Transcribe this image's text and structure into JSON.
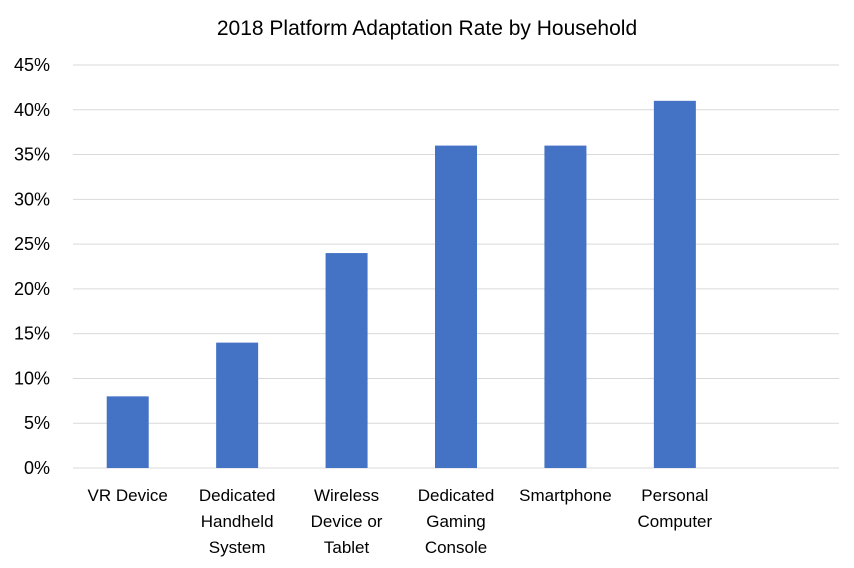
{
  "chart_data": {
    "type": "bar",
    "title": "2018 Platform Adaptation Rate by Household",
    "xlabel": "",
    "ylabel": "",
    "categories": [
      [
        "VR Device"
      ],
      [
        "Dedicated",
        "Handheld",
        "System"
      ],
      [
        "Wireless",
        "Device or",
        "Tablet"
      ],
      [
        "Dedicated",
        "Gaming",
        "Console"
      ],
      [
        "Smartphone"
      ],
      [
        "Personal",
        "Computer"
      ],
      [
        ""
      ]
    ],
    "category_names": [
      "VR Device",
      "Dedicated Handheld System",
      "Wireless Device or Tablet",
      "Dedicated Gaming Console",
      "Smartphone",
      "Personal Computer",
      ""
    ],
    "values": [
      8,
      14,
      24,
      36,
      36,
      41,
      null
    ],
    "unit": "%",
    "ylim": [
      0,
      45
    ],
    "yticks": [
      0,
      5,
      10,
      15,
      20,
      25,
      30,
      35,
      40,
      45
    ],
    "ytick_labels": [
      "0%",
      "5%",
      "10%",
      "15%",
      "20%",
      "25%",
      "30%",
      "35%",
      "40%",
      "45%"
    ],
    "grid": true,
    "legend": "none",
    "bar_color": "#4472c4",
    "grid_color": "#d9d9d9"
  }
}
